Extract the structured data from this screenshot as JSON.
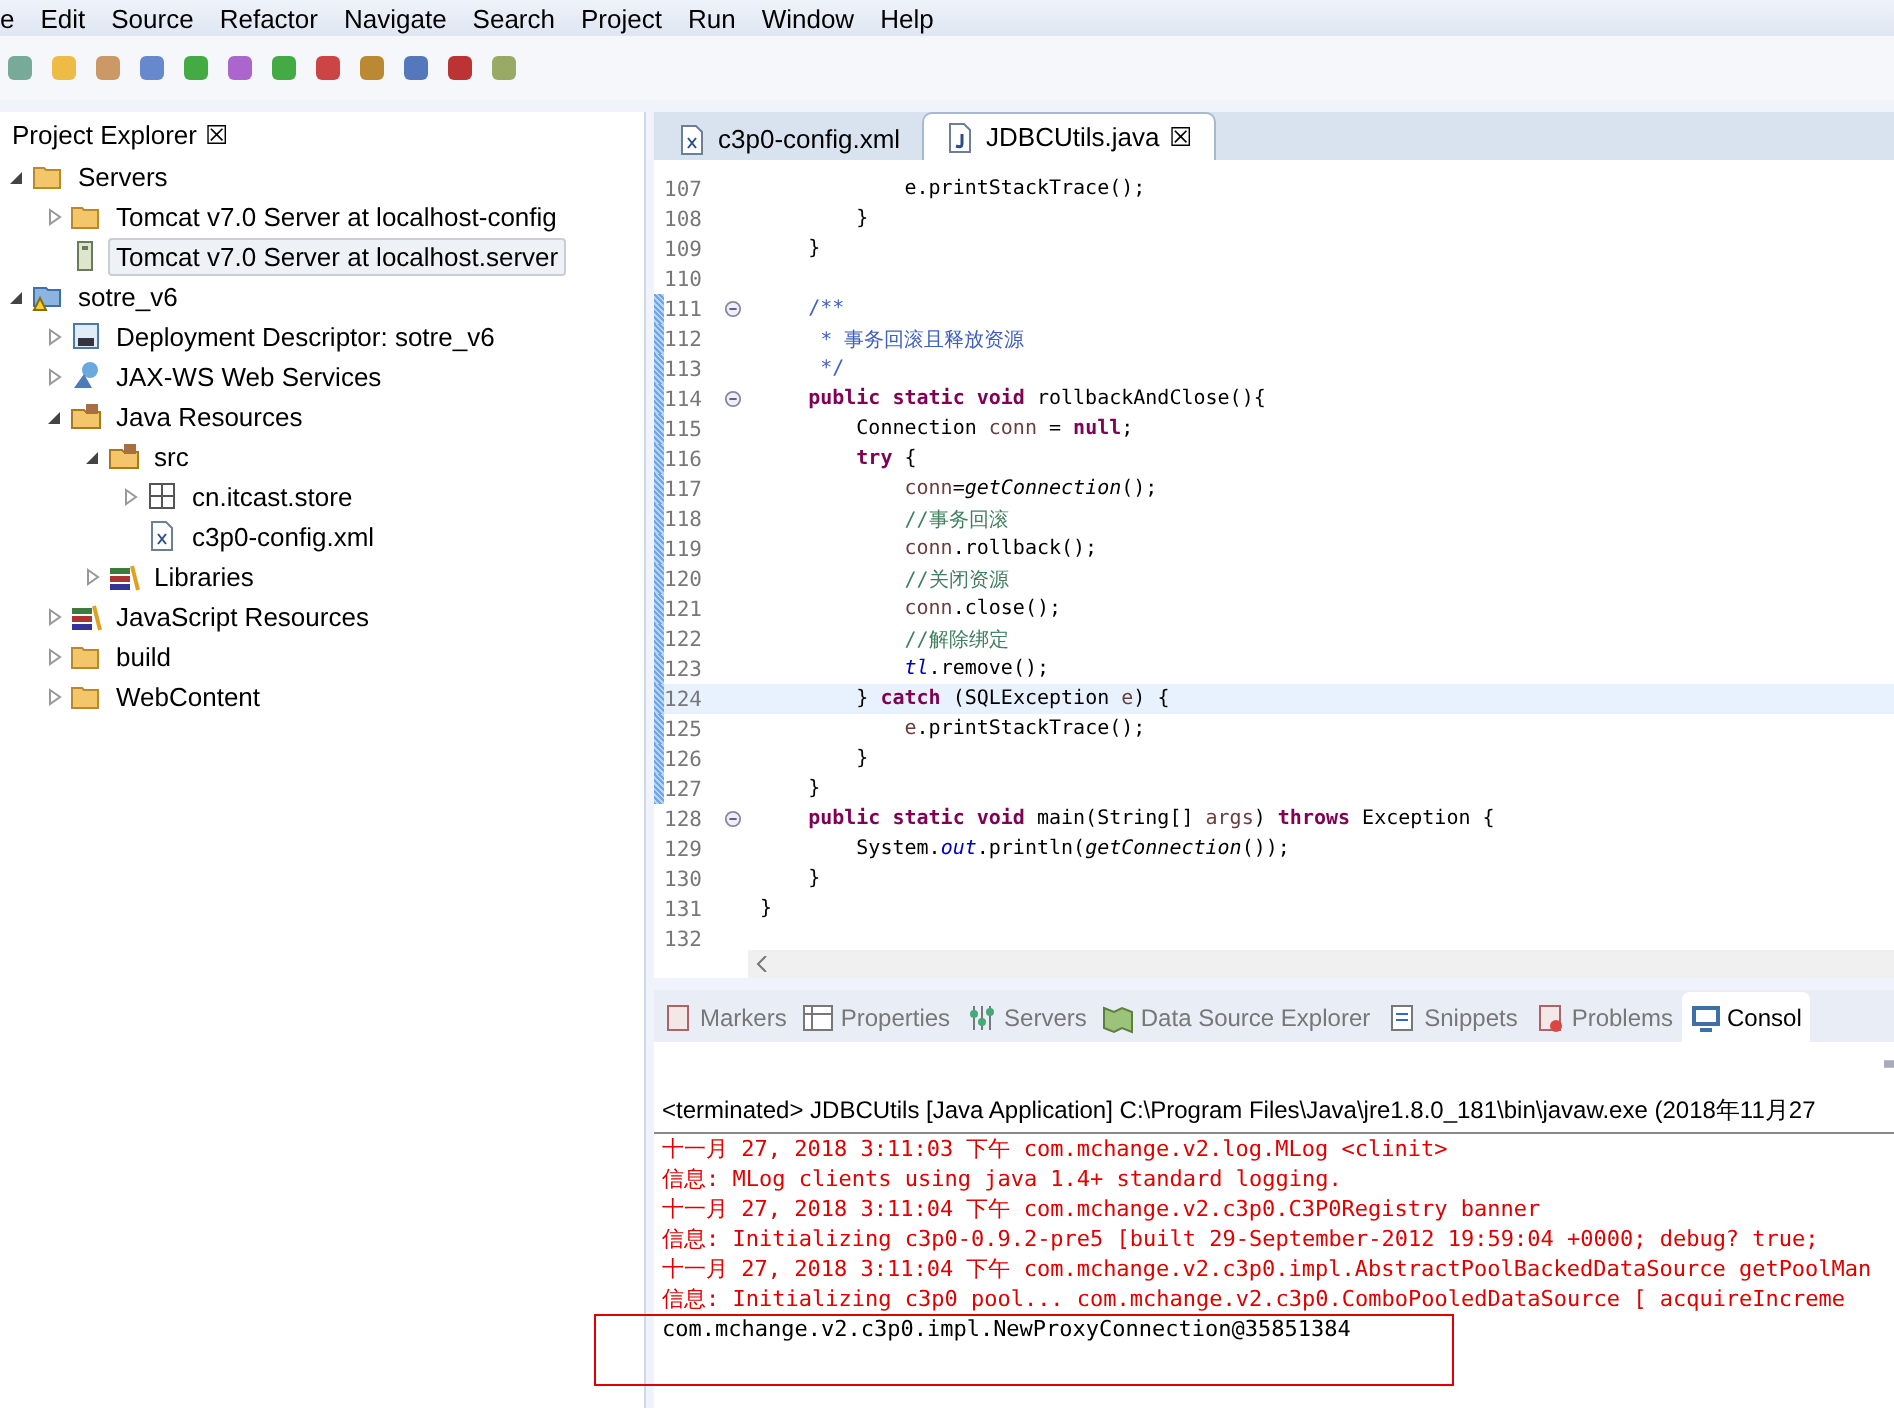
{
  "menu": [
    "e",
    "Edit",
    "Source",
    "Refactor",
    "Navigate",
    "Search",
    "Project",
    "Run",
    "Window",
    "Help"
  ],
  "explorer": {
    "title": "Project Explorer",
    "close": "☒",
    "tree": [
      {
        "label": "Servers",
        "kind": "folder",
        "expanded": true,
        "selected": false,
        "children": [
          {
            "label": "Tomcat v7.0 Server at localhost-config",
            "kind": "folder",
            "expanded": false,
            "selected": false
          },
          {
            "label": "Tomcat v7.0 Server at localhost.server",
            "kind": "server",
            "selected": true
          }
        ]
      },
      {
        "label": "sotre_v6",
        "kind": "project",
        "expanded": true,
        "selected": false,
        "children": [
          {
            "label": "Deployment Descriptor: sotre_v6",
            "kind": "descriptor",
            "expanded": false,
            "selected": false
          },
          {
            "label": "JAX-WS Web Services",
            "kind": "webservice",
            "expanded": false,
            "selected": false
          },
          {
            "label": "Java Resources",
            "kind": "package-folder",
            "expanded": true,
            "selected": false,
            "children": [
              {
                "label": "src",
                "kind": "package-folder",
                "expanded": true,
                "selected": false,
                "children": [
                  {
                    "label": "cn.itcast.store",
                    "kind": "package",
                    "expanded": false,
                    "selected": false
                  },
                  {
                    "label": "c3p0-config.xml",
                    "kind": "xml",
                    "selected": false
                  }
                ]
              },
              {
                "label": "Libraries",
                "kind": "library",
                "expanded": false,
                "selected": false
              }
            ]
          },
          {
            "label": "JavaScript Resources",
            "kind": "library",
            "expanded": false,
            "selected": false
          },
          {
            "label": "build",
            "kind": "folder",
            "expanded": false,
            "selected": false
          },
          {
            "label": "WebContent",
            "kind": "folder",
            "expanded": false,
            "selected": false
          }
        ]
      }
    ]
  },
  "editor": {
    "tabs": [
      {
        "label": "c3p0-config.xml",
        "kind": "xml",
        "selected": false
      },
      {
        "label": "JDBCUtils.java",
        "kind": "java",
        "selected": true,
        "close": "☒"
      }
    ],
    "lines": [
      {
        "number": "107",
        "changed": false,
        "current": false,
        "foldable": false,
        "tokens": [
          {
            "t": "            e.printStackTrace();",
            "kind": "plain"
          }
        ]
      },
      {
        "number": "108",
        "changed": false,
        "current": false,
        "foldable": false,
        "tokens": [
          {
            "t": "        }",
            "kind": "plain"
          }
        ]
      },
      {
        "number": "109",
        "changed": false,
        "current": false,
        "foldable": false,
        "tokens": [
          {
            "t": "    }",
            "kind": "plain"
          }
        ]
      },
      {
        "number": "110",
        "changed": false,
        "current": false,
        "foldable": false
      },
      {
        "number": "111",
        "changed": true,
        "current": false,
        "foldable": true,
        "tokens": [
          {
            "t": "    /**",
            "kind": "doc"
          }
        ]
      },
      {
        "number": "112",
        "changed": true,
        "current": false,
        "foldable": false,
        "tokens": [
          {
            "t": "     * ",
            "kind": "doc"
          },
          {
            "t": "事务回滚且释放资源",
            "kind": "doc-cjk"
          }
        ]
      },
      {
        "number": "113",
        "changed": true,
        "current": false,
        "foldable": false,
        "tokens": [
          {
            "t": "     */",
            "kind": "doc"
          }
        ]
      },
      {
        "number": "114",
        "changed": true,
        "current": false,
        "foldable": true,
        "tokens": [
          {
            "t": "    public static void",
            "kind": "keyword"
          },
          {
            "t": " rollbackAndClose(){",
            "kind": "plain"
          }
        ]
      },
      {
        "number": "115",
        "changed": true,
        "current": false,
        "foldable": false,
        "tokens": [
          {
            "t": "        Connection ",
            "kind": "plain"
          },
          {
            "t": "conn",
            "kind": "local"
          },
          {
            "t": " = ",
            "kind": "plain"
          },
          {
            "t": "null",
            "kind": "keyword"
          },
          {
            "t": ";",
            "kind": "plain"
          }
        ]
      },
      {
        "number": "116",
        "changed": true,
        "current": false,
        "foldable": false,
        "tokens": [
          {
            "t": "        try",
            "kind": "keyword"
          },
          {
            "t": " {",
            "kind": "plain"
          }
        ]
      },
      {
        "number": "117",
        "changed": true,
        "current": false,
        "foldable": false,
        "tokens": [
          {
            "t": "            conn",
            "kind": "local"
          },
          {
            "t": "=",
            "kind": "plain"
          },
          {
            "t": "getConnection",
            "kind": "static-call"
          },
          {
            "t": "();",
            "kind": "plain"
          }
        ]
      },
      {
        "number": "118",
        "changed": true,
        "current": false,
        "foldable": false,
        "tokens": [
          {
            "t": "            //",
            "kind": "comment"
          },
          {
            "t": "事务回滚",
            "kind": "comment-cjk"
          }
        ]
      },
      {
        "number": "119",
        "changed": true,
        "current": false,
        "foldable": false,
        "tokens": [
          {
            "t": "            conn",
            "kind": "local"
          },
          {
            "t": ".rollback();",
            "kind": "plain"
          }
        ]
      },
      {
        "number": "120",
        "changed": true,
        "current": false,
        "foldable": false,
        "tokens": [
          {
            "t": "            //",
            "kind": "comment"
          },
          {
            "t": "关闭资源",
            "kind": "comment-cjk"
          }
        ]
      },
      {
        "number": "121",
        "changed": true,
        "current": false,
        "foldable": false,
        "tokens": [
          {
            "t": "            conn",
            "kind": "local"
          },
          {
            "t": ".close();",
            "kind": "plain"
          }
        ]
      },
      {
        "number": "122",
        "changed": true,
        "current": false,
        "foldable": false,
        "tokens": [
          {
            "t": "            //",
            "kind": "comment"
          },
          {
            "t": "解除绑定",
            "kind": "comment-cjk"
          }
        ]
      },
      {
        "number": "123",
        "changed": true,
        "current": false,
        "foldable": false,
        "tokens": [
          {
            "t": "            tl",
            "kind": "static-field"
          },
          {
            "t": ".remove();",
            "kind": "plain"
          }
        ]
      },
      {
        "number": "124",
        "changed": true,
        "current": true,
        "foldable": false,
        "tokens": [
          {
            "t": "        } ",
            "kind": "plain"
          },
          {
            "t": "catch",
            "kind": "keyword"
          },
          {
            "t": " (SQLException ",
            "kind": "plain"
          },
          {
            "t": "e",
            "kind": "local"
          },
          {
            "t": ") {",
            "kind": "plain"
          }
        ]
      },
      {
        "number": "125",
        "changed": true,
        "current": false,
        "foldable": false,
        "tokens": [
          {
            "t": "            e",
            "kind": "local"
          },
          {
            "t": ".printStackTrace();",
            "kind": "plain"
          }
        ]
      },
      {
        "number": "126",
        "changed": true,
        "current": false,
        "foldable": false,
        "tokens": [
          {
            "t": "        }",
            "kind": "plain"
          }
        ]
      },
      {
        "number": "127",
        "changed": true,
        "current": false,
        "foldable": false,
        "tokens": [
          {
            "t": "    }",
            "kind": "plain"
          }
        ]
      },
      {
        "number": "128",
        "changed": false,
        "current": false,
        "foldable": true,
        "tokens": [
          {
            "t": "    public static void",
            "kind": "keyword"
          },
          {
            "t": " main(String[] ",
            "kind": "plain"
          },
          {
            "t": "args",
            "kind": "local"
          },
          {
            "t": ") ",
            "kind": "plain"
          },
          {
            "t": "throws",
            "kind": "keyword"
          },
          {
            "t": " Exception {",
            "kind": "plain"
          }
        ]
      },
      {
        "number": "129",
        "changed": false,
        "current": false,
        "foldable": false,
        "tokens": [
          {
            "t": "        System.",
            "kind": "plain"
          },
          {
            "t": "out",
            "kind": "static-field"
          },
          {
            "t": ".println(",
            "kind": "plain"
          },
          {
            "t": "getConnection",
            "kind": "static-call"
          },
          {
            "t": "());",
            "kind": "plain"
          }
        ]
      },
      {
        "number": "130",
        "changed": false,
        "current": false,
        "foldable": false,
        "tokens": [
          {
            "t": "    }",
            "kind": "plain"
          }
        ]
      },
      {
        "number": "131",
        "changed": false,
        "current": false,
        "foldable": false,
        "tokens": [
          {
            "t": "}",
            "kind": "plain"
          }
        ]
      },
      {
        "number": "132",
        "changed": false,
        "current": false,
        "foldable": false
      }
    ]
  },
  "views": {
    "tabs": [
      {
        "label": "Markers",
        "kind": "markers",
        "selected": false
      },
      {
        "label": "Properties",
        "kind": "properties",
        "selected": false
      },
      {
        "label": "Servers",
        "kind": "servers",
        "selected": false
      },
      {
        "label": "Data Source Explorer",
        "kind": "datasource",
        "selected": false
      },
      {
        "label": "Snippets",
        "kind": "snippets",
        "selected": false
      },
      {
        "label": "Problems",
        "kind": "problems",
        "selected": false
      },
      {
        "label": "Consol",
        "kind": "console",
        "selected": true
      }
    ],
    "console_header": "<terminated> JDBCUtils [Java Application] C:\\Program Files\\Java\\jre1.8.0_181\\bin\\javaw.exe (2018年11月27",
    "console_lines": [
      {
        "kind": "stderr",
        "text": "十一月 27, 2018 3:11:03 下午 com.mchange.v2.log.MLog <clinit>"
      },
      {
        "kind": "stderr",
        "text": "信息: MLog clients using java 1.4+ standard logging."
      },
      {
        "kind": "stderr",
        "text": "十一月 27, 2018 3:11:04 下午 com.mchange.v2.c3p0.C3P0Registry banner"
      },
      {
        "kind": "stderr",
        "text": "信息: Initializing c3p0-0.9.2-pre5 [built 29-September-2012 19:59:04 +0000; debug? true;"
      },
      {
        "kind": "stderr",
        "text": "十一月 27, 2018 3:11:04 下午 com.mchange.v2.c3p0.impl.AbstractPoolBackedDataSource getPoolMan"
      },
      {
        "kind": "stderr",
        "text": "信息: Initializing c3p0 pool... com.mchange.v2.c3p0.ComboPooledDataSource [ acquireIncreme"
      },
      {
        "kind": "stdout",
        "text": "com.mchange.v2.c3p0.impl.NewProxyConnection@35851384"
      }
    ]
  }
}
